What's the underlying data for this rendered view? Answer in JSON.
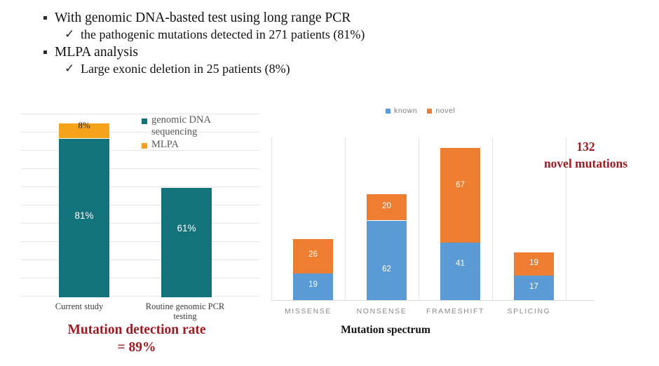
{
  "bullets": [
    {
      "level": 1,
      "marker": "square-bullet",
      "text": "With genomic DNA-basted test using long range PCR"
    },
    {
      "level": 2,
      "marker": "check-bullet",
      "text": "the pathogenic mutations detected in 271 patients (81%)"
    },
    {
      "level": 1,
      "marker": "square-bullet",
      "text": "MLPA analysis"
    },
    {
      "level": 2,
      "marker": "check-bullet",
      "text": "Large exonic deletion in 25 patients (8%)"
    }
  ],
  "colors": {
    "teal": "#13737A",
    "orange": "#F5A31A",
    "bar_orange": "#ED7D31",
    "bar_blue": "#5B9BD5",
    "dark_red": "#9E1B22",
    "gridline": "#e6e6e6"
  },
  "left_chart": {
    "legend": [
      {
        "label": "genomic DNA sequencing",
        "color": "#13737A"
      },
      {
        "label": "MLPA",
        "color": "#F5A31A"
      }
    ],
    "categories": [
      "Current study",
      "Routine genomic PCR testing"
    ],
    "labels": {
      "current_mlpa": "8%",
      "current_gdna": "81%",
      "routine_gdna": "61%"
    },
    "caption_line1": "Mutation detection rate",
    "caption_line2": "= 89%"
  },
  "right_chart": {
    "legend": [
      {
        "label": "known",
        "color": "#5B9BD5"
      },
      {
        "label": "novel",
        "color": "#ED7D31"
      }
    ],
    "axis_title": "Mutation spectrum",
    "annotation_line1": "132",
    "annotation_line2": "novel mutations"
  },
  "chart_data": [
    {
      "type": "bar",
      "id": "mutation-detection-rate-chart",
      "stacked": true,
      "title": "",
      "xlabel": "",
      "ylabel": "",
      "ylim": [
        0,
        100
      ],
      "grid": true,
      "legend_position": "inside-top-right",
      "categories": [
        "Current study",
        "Routine genomic PCR testing"
      ],
      "series": [
        {
          "name": "genomic DNA sequencing",
          "color": "#13737A",
          "values": [
            81,
            61
          ],
          "labels": [
            "81%",
            "61%"
          ]
        },
        {
          "name": "MLPA",
          "color": "#F5A31A",
          "values": [
            8,
            0
          ],
          "labels": [
            "8%",
            ""
          ]
        }
      ],
      "annotations": [
        "Mutation detection rate = 89%"
      ]
    },
    {
      "type": "bar",
      "id": "mutation-spectrum-chart",
      "stacked": true,
      "title": "",
      "xlabel": "Mutation spectrum",
      "ylabel": "",
      "ylim": [
        0,
        120
      ],
      "grid": false,
      "legend_position": "top",
      "categories": [
        "MISSENSE",
        "NONSENSE",
        "FRAMESHIFT",
        "SPLICING"
      ],
      "series": [
        {
          "name": "known",
          "color": "#5B9BD5",
          "values": [
            19,
            62,
            41,
            17
          ],
          "labels": [
            "19",
            "62",
            "41",
            "17"
          ]
        },
        {
          "name": "novel",
          "color": "#ED7D31",
          "values": [
            26,
            20,
            67,
            19
          ],
          "labels": [
            "26",
            "20",
            "67",
            "19"
          ]
        }
      ],
      "annotations": [
        "132 novel mutations"
      ]
    }
  ]
}
